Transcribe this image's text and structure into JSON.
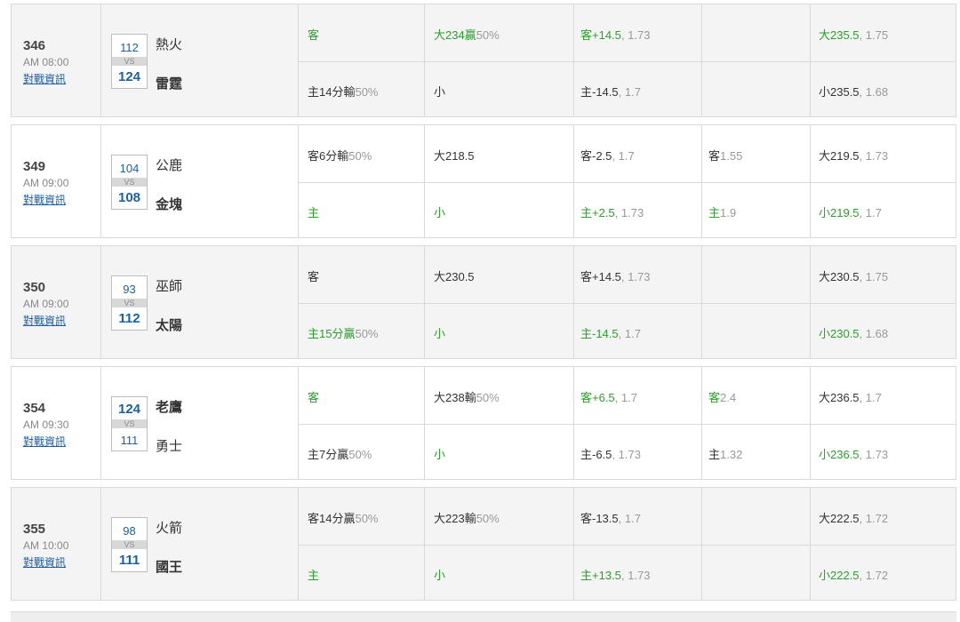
{
  "vs_label": "VS",
  "match_link_label": "對戰資訊",
  "colors": {
    "win_text": "#2aa02a",
    "score_blue": "#1a5fa8",
    "muted": "#999999"
  },
  "games": [
    {
      "number": "346",
      "time": "AM 08:00",
      "away": {
        "score": "112",
        "name": "熱火",
        "winner": false
      },
      "home": {
        "score": "124",
        "name": "雷霆",
        "winner": true
      },
      "rows": [
        {
          "spread_result": {
            "main": "客",
            "sub": "",
            "win": true
          },
          "total_result": {
            "main": "大234贏",
            "sub": "50%",
            "win": true
          },
          "spread_line": {
            "main": "客+14.5",
            "sub": ", 1.73",
            "win": true
          },
          "moneyline": {
            "main": "",
            "sub": "",
            "win": false
          },
          "total_line": {
            "main": "大235.5",
            "sub": ", 1.75",
            "win": true
          }
        },
        {
          "spread_result": {
            "main": "主14分輸",
            "sub": "50%",
            "win": false
          },
          "total_result": {
            "main": "小",
            "sub": "",
            "win": false
          },
          "spread_line": {
            "main": "主-14.5",
            "sub": ", 1.7",
            "win": false
          },
          "moneyline": {
            "main": "",
            "sub": "",
            "win": false
          },
          "total_line": {
            "main": "小235.5",
            "sub": ", 1.68",
            "win": false
          }
        }
      ]
    },
    {
      "number": "349",
      "time": "AM 09:00",
      "away": {
        "score": "104",
        "name": "公鹿",
        "winner": false
      },
      "home": {
        "score": "108",
        "name": "金塊",
        "winner": true
      },
      "rows": [
        {
          "spread_result": {
            "main": "客6分輸",
            "sub": "50%",
            "win": false
          },
          "total_result": {
            "main": "大218.5",
            "sub": "",
            "win": false
          },
          "spread_line": {
            "main": "客-2.5",
            "sub": ", 1.7",
            "win": false
          },
          "moneyline": {
            "main": "客",
            "sub": "1.55",
            "win": false
          },
          "total_line": {
            "main": "大219.5",
            "sub": ", 1.73",
            "win": false
          }
        },
        {
          "spread_result": {
            "main": "主",
            "sub": "",
            "win": true
          },
          "total_result": {
            "main": "小",
            "sub": "",
            "win": true
          },
          "spread_line": {
            "main": "主+2.5",
            "sub": ", 1.73",
            "win": true
          },
          "moneyline": {
            "main": "主",
            "sub": "1.9",
            "win": true
          },
          "total_line": {
            "main": "小219.5",
            "sub": ", 1.7",
            "win": true
          }
        }
      ]
    },
    {
      "number": "350",
      "time": "AM 09:00",
      "away": {
        "score": "93",
        "name": "巫師",
        "winner": false
      },
      "home": {
        "score": "112",
        "name": "太陽",
        "winner": true
      },
      "rows": [
        {
          "spread_result": {
            "main": "客",
            "sub": "",
            "win": false
          },
          "total_result": {
            "main": "大230.5",
            "sub": "",
            "win": false
          },
          "spread_line": {
            "main": "客+14.5",
            "sub": ", 1.73",
            "win": false
          },
          "moneyline": {
            "main": "",
            "sub": "",
            "win": false
          },
          "total_line": {
            "main": "大230.5",
            "sub": ", 1.75",
            "win": false
          }
        },
        {
          "spread_result": {
            "main": "主15分贏",
            "sub": "50%",
            "win": true
          },
          "total_result": {
            "main": "小",
            "sub": "",
            "win": true
          },
          "spread_line": {
            "main": "主-14.5",
            "sub": ", 1.7",
            "win": true
          },
          "moneyline": {
            "main": "",
            "sub": "",
            "win": false
          },
          "total_line": {
            "main": "小230.5",
            "sub": ", 1.68",
            "win": true
          }
        }
      ]
    },
    {
      "number": "354",
      "time": "AM 09:30",
      "away": {
        "score": "124",
        "name": "老鷹",
        "winner": true
      },
      "home": {
        "score": "111",
        "name": "勇士",
        "winner": false
      },
      "rows": [
        {
          "spread_result": {
            "main": "客",
            "sub": "",
            "win": true
          },
          "total_result": {
            "main": "大238輸",
            "sub": "50%",
            "win": false
          },
          "spread_line": {
            "main": "客+6.5",
            "sub": ", 1.7",
            "win": true
          },
          "moneyline": {
            "main": "客",
            "sub": "2.4",
            "win": true
          },
          "total_line": {
            "main": "大236.5",
            "sub": ", 1.7",
            "win": false
          }
        },
        {
          "spread_result": {
            "main": "主7分贏",
            "sub": "50%",
            "win": false
          },
          "total_result": {
            "main": "小",
            "sub": "",
            "win": true
          },
          "spread_line": {
            "main": "主-6.5",
            "sub": ", 1.73",
            "win": false
          },
          "moneyline": {
            "main": "主",
            "sub": "1.32",
            "win": false
          },
          "total_line": {
            "main": "小236.5",
            "sub": ", 1.73",
            "win": true
          }
        }
      ]
    },
    {
      "number": "355",
      "time": "AM 10:00",
      "away": {
        "score": "98",
        "name": "火箭",
        "winner": false
      },
      "home": {
        "score": "111",
        "name": "國王",
        "winner": true
      },
      "rows": [
        {
          "spread_result": {
            "main": "客14分贏",
            "sub": "50%",
            "win": false
          },
          "total_result": {
            "main": "大223輸",
            "sub": "50%",
            "win": false
          },
          "spread_line": {
            "main": "客-13.5",
            "sub": ", 1.7",
            "win": false
          },
          "moneyline": {
            "main": "",
            "sub": "",
            "win": false
          },
          "total_line": {
            "main": "大222.5",
            "sub": ", 1.72",
            "win": false
          }
        },
        {
          "spread_result": {
            "main": "主",
            "sub": "",
            "win": true
          },
          "total_result": {
            "main": "小",
            "sub": "",
            "win": true
          },
          "spread_line": {
            "main": "主+13.5",
            "sub": ", 1.73",
            "win": true
          },
          "moneyline": {
            "main": "",
            "sub": "",
            "win": false
          },
          "total_line": {
            "main": "小222.5",
            "sub": ", 1.72",
            "win": true
          }
        }
      ]
    }
  ]
}
